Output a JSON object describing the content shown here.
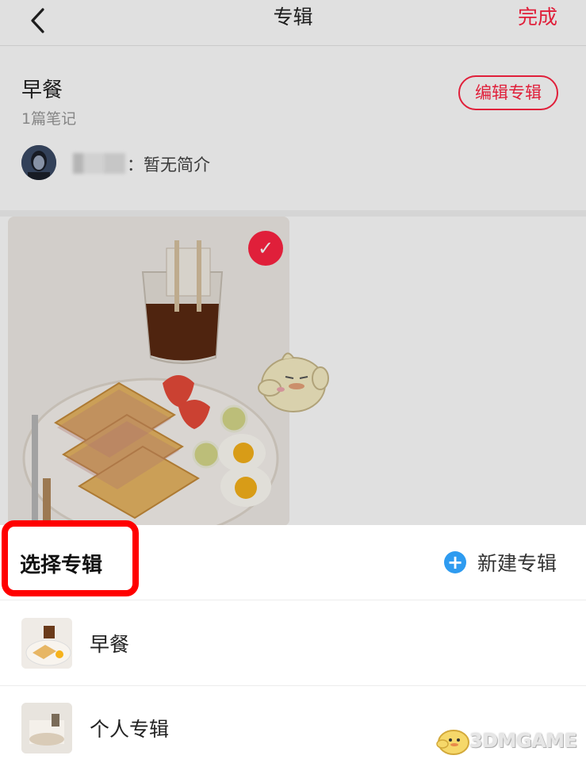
{
  "topbar": {
    "title": "专辑",
    "done_label": "完成"
  },
  "album": {
    "name": "早餐",
    "note_count": "1篇笔记",
    "edit_label": "编辑专辑",
    "author_intro": "：暂无简介"
  },
  "sheet": {
    "title": "选择专辑",
    "new_album_label": "新建专辑",
    "albums": [
      {
        "label": "早餐"
      },
      {
        "label": "个人专辑"
      }
    ]
  },
  "watermark": {
    "text": "3DMGAME"
  },
  "colors": {
    "accent": "#ff2442",
    "highlight": "#ff0000",
    "plus": "#2e9bf0"
  }
}
